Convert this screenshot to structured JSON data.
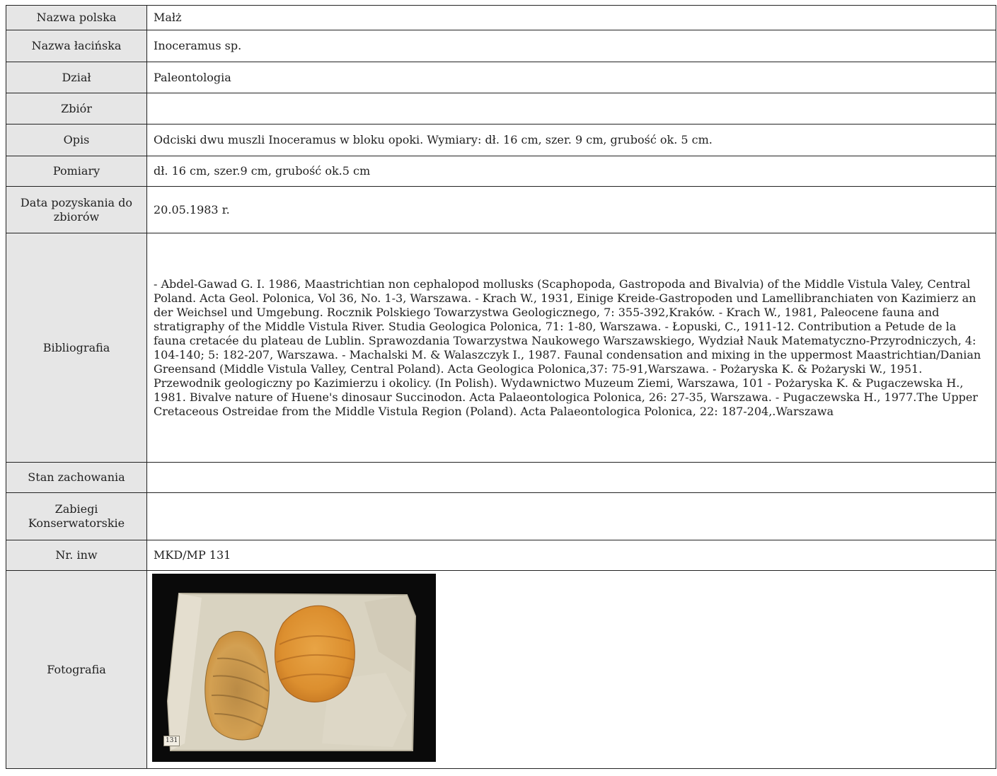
{
  "rows": [
    {
      "label": "Nazwa polska",
      "value": "Małż"
    },
    {
      "label": "Nazwa łacińska",
      "value": "Inoceramus sp."
    },
    {
      "label": "Dział",
      "value": "Paleontologia"
    },
    {
      "label": "Zbiór",
      "value": ""
    },
    {
      "label": "Opis",
      "value": "Odciski dwu muszli Inoceramus w bloku opoki. Wymiary: dł. 16 cm, szer. 9 cm, grubość ok. 5 cm."
    },
    {
      "label": "Pomiary",
      "value": "dł. 16 cm, szer.9 cm, grubość ok.5 cm"
    },
    {
      "label": "Data pozyskania do zbiorów",
      "value": "20.05.1983 r."
    },
    {
      "label": "Bibliografia",
      "value": "- Abdel-Gawad G. I. 1986, Maastrichtian non cephalopod mollusks (Scaphopoda, Gastropoda and Bivalvia) of the Middle Vistula Valey, Central Poland. Acta Geol. Polonica, Vol 36, No. 1-3, Warszawa. - Krach W., 1931, Einige Kreide-Gastropoden und Lamellibranchiaten von Kazimierz an der Weichsel und Umgebung. Rocznik Polskiego Towarzystwa Geologicznego, 7: 355-392,Kraków. - Krach W., 1981, Paleocene fauna and stratigraphy of the Middle Vistula River. Studia Geologica Polonica, 71: 1-80, Warszawa. - Łopuski, C., 1911-12. Contribution a Petude de la fauna cretacée du plateau de Lublin. Sprawozdania Towarzystwa Naukowego Warszawskiego, Wydział Nauk Matematyczno-Przyrodniczych, 4: 104-140; 5: 182-207, Warszawa. - Machalski M. & Walaszczyk I., 1987. Faunal condensation and mixing in the uppermost Maastrichtian/Danian Greensand (Middle Vistula Valley, Central Poland). Acta Geologica Polonica,37: 75-91,Warszawa. - Pożaryska K. & Pożaryski W., 1951. Przewodnik geologiczny po Kazimierzu i okolicy. (In Polish). Wydawnictwo Muzeum Ziemi, Warszawa, 101 - Pożaryska K. & Pugaczewska H., 1981. Bivalve nature of Huene's dinosaur Succinodon. Acta Palaeontologica Polonica, 26: 27-35, Warszawa. - Pugaczewska H., 1977.The Upper Cretaceous Ostreidae from the Middle Vistula Region (Poland). Acta Palaeontologica Polonica, 22: 187-204,.Warszawa"
    },
    {
      "label": "Stan zachowania",
      "value": ""
    },
    {
      "label": "Zabiegi Konserwatorskie",
      "value": ""
    },
    {
      "label": "Nr. inw",
      "value": "MKD/MP 131"
    },
    {
      "label": "Fotografia",
      "value": ""
    }
  ],
  "photo": {
    "specimen_tag": "131"
  },
  "colors": {
    "label_bg": "#e6e6e6",
    "border": "#222222",
    "photo_bg": "#0a0a0a",
    "shell": "#d9963c"
  }
}
